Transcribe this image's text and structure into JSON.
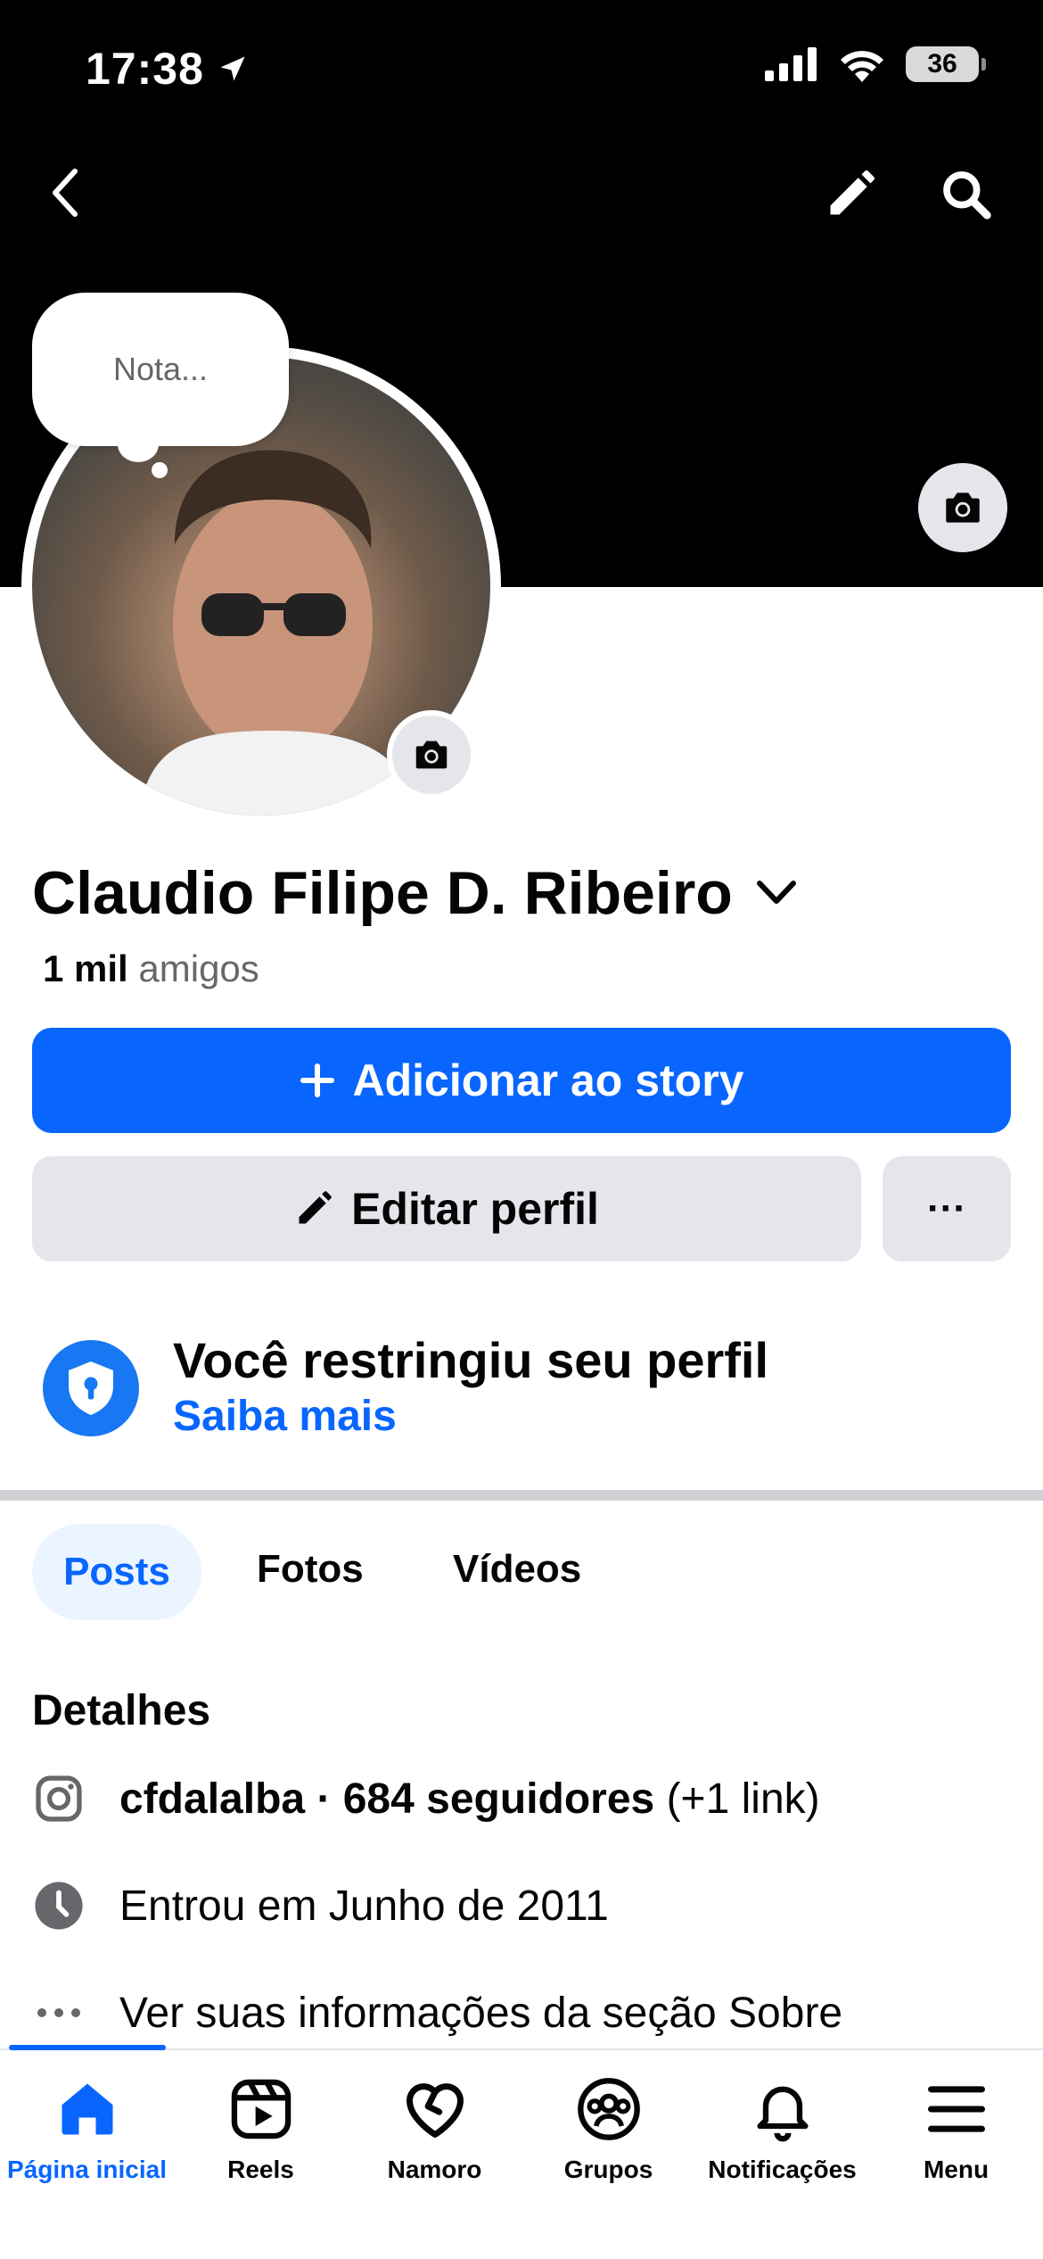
{
  "status_bar": {
    "time": "17:38",
    "battery": "36"
  },
  "note": {
    "placeholder": "Nota..."
  },
  "profile": {
    "name": "Claudio Filipe D. Ribeiro",
    "friends_count": "1 mil",
    "friends_label": "amigos"
  },
  "actions": {
    "add_story": "Adicionar ao story",
    "edit_profile": "Editar perfil",
    "more": "···"
  },
  "restricted": {
    "title": "Você restringiu seu perfil",
    "link": "Saiba mais"
  },
  "tabs": [
    {
      "label": "Posts"
    },
    {
      "label": "Fotos"
    },
    {
      "label": "Vídeos"
    }
  ],
  "details": {
    "title": "Detalhes",
    "instagram": {
      "handle": "cfdalalba · 684 seguidores",
      "extra": " (+1 link)"
    },
    "joined": "Entrou em Junho de 2011",
    "about": "Ver suas informações da seção Sobre"
  },
  "bottom_nav": [
    {
      "label": "Página inicial",
      "icon": "home-icon",
      "active": true
    },
    {
      "label": "Reels",
      "icon": "reels-icon"
    },
    {
      "label": "Namoro",
      "icon": "heart-icon"
    },
    {
      "label": "Grupos",
      "icon": "groups-icon"
    },
    {
      "label": "Notificações",
      "icon": "bell-icon"
    },
    {
      "label": "Menu",
      "icon": "menu-icon"
    }
  ],
  "colors": {
    "accent": "#0866ff",
    "secondary_button": "#e4e6eb",
    "muted_text": "#65676b"
  }
}
